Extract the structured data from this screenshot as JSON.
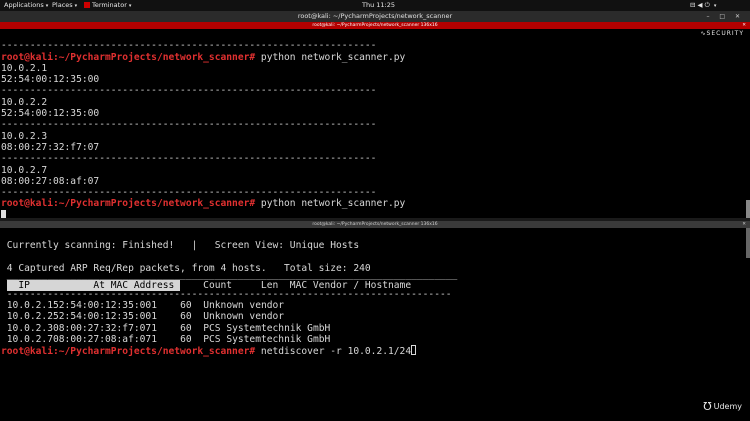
{
  "topbar": {
    "applications": "Applications",
    "places": "Places",
    "terminator": "Terminator",
    "clock": "Thu 11:25"
  },
  "window": {
    "title": "root@kali: ~/PycharmProjects/network_scanner",
    "buttons": "– □ ✕"
  },
  "pane1": {
    "header": "root@kali: ~/PycharmProjects/network_scanner 136x16",
    "watermark": "SECURITY",
    "sep_top": "--------------------------------------------------------------------------------------------------------",
    "prompt_user": "root@kali",
    "prompt_path": ":~/PycharmProjects/network_scanner",
    "command": " python network_scanner.py",
    "entries": [
      {
        "ip": "10.0.2.1",
        "mac": "52:54:00:12:35:00"
      },
      {
        "ip": "10.0.2.2",
        "mac": "52:54:00:12:35:00"
      },
      {
        "ip": "10.0.2.3",
        "mac": "08:00:27:32:f7:07"
      },
      {
        "ip": "10.0.2.7",
        "mac": "08:00:27:08:af:07"
      }
    ],
    "separator": "-----------------------------------------------------------------"
  },
  "pane2": {
    "header": "root@kali: ~/PycharmProjects/network_scanner 136x16",
    "status": " Currently scanning: Finished!   |   Screen View: Unique Hosts",
    "summary": " 4 Captured ARP Req/Rep packets, from 4 hosts.   Total size: 240",
    "columns_highlight": "  IP           At MAC Address ",
    "columns_rest": "    Count     Len  MAC Vendor / Hostname",
    "top_rule": " ______________________________________________________________________________",
    "rule": " -----------------------------------------------------------------------------",
    "rows": [
      {
        "ip": "10.0.2.1",
        "mac": "52:54:00:12:35:00",
        "count": "1",
        "len": "60",
        "vendor": "Unknown vendor"
      },
      {
        "ip": "10.0.2.2",
        "mac": "52:54:00:12:35:00",
        "count": "1",
        "len": "60",
        "vendor": "Unknown vendor"
      },
      {
        "ip": "10.0.2.3",
        "mac": "08:00:27:32:f7:07",
        "count": "1",
        "len": "60",
        "vendor": "PCS Systemtechnik GmbH"
      },
      {
        "ip": "10.0.2.7",
        "mac": "08:00:27:08:af:07",
        "count": "1",
        "len": "60",
        "vendor": "PCS Systemtechnik GmbH"
      }
    ],
    "command": " netdiscover -r 10.0.2.1/24"
  },
  "udemy": "Udemy"
}
